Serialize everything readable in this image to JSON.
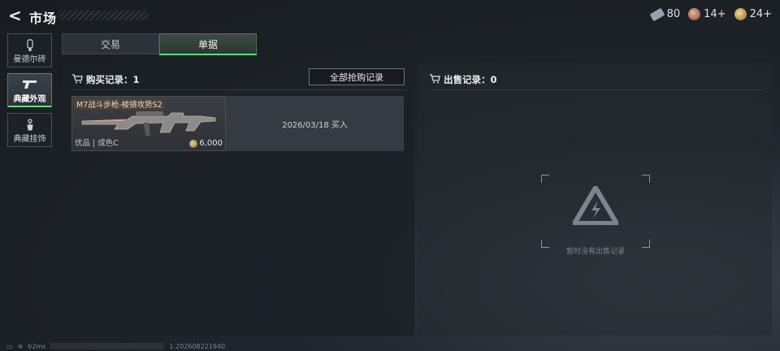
{
  "header": {
    "back_glyph": "<",
    "title": "市场",
    "currencies": [
      {
        "icon": "banknote-icon",
        "value": "80"
      },
      {
        "icon": "red-coin-icon",
        "value": "14+"
      },
      {
        "icon": "gold-coin-icon",
        "value": "24+"
      }
    ]
  },
  "sidebar": {
    "items": [
      {
        "label": "曼德尔砖",
        "icon": "brick-icon",
        "active": false
      },
      {
        "label": "典藏外观",
        "icon": "pistol-icon",
        "active": true
      },
      {
        "label": "典藏挂饰",
        "icon": "charm-icon",
        "active": false
      }
    ]
  },
  "tabs": [
    {
      "label": "交易",
      "active": false
    },
    {
      "label": "单据",
      "active": true
    }
  ],
  "purchase": {
    "title": "购买记录：1",
    "all_button": "全部抢购记录",
    "records": [
      {
        "name": "M7战斗步枪-棱镜攻势S2",
        "quality": "优品 | 成色C",
        "price": "6,000",
        "info": "2026/03/18 买入"
      }
    ]
  },
  "sales": {
    "title": "出售记录：0",
    "empty_text": "暂时没有出售记录"
  },
  "footer": {
    "ping": "62ms",
    "build": "1.202608221940"
  },
  "colors": {
    "accent": "#5fdf7a",
    "background": "#1b2025"
  }
}
